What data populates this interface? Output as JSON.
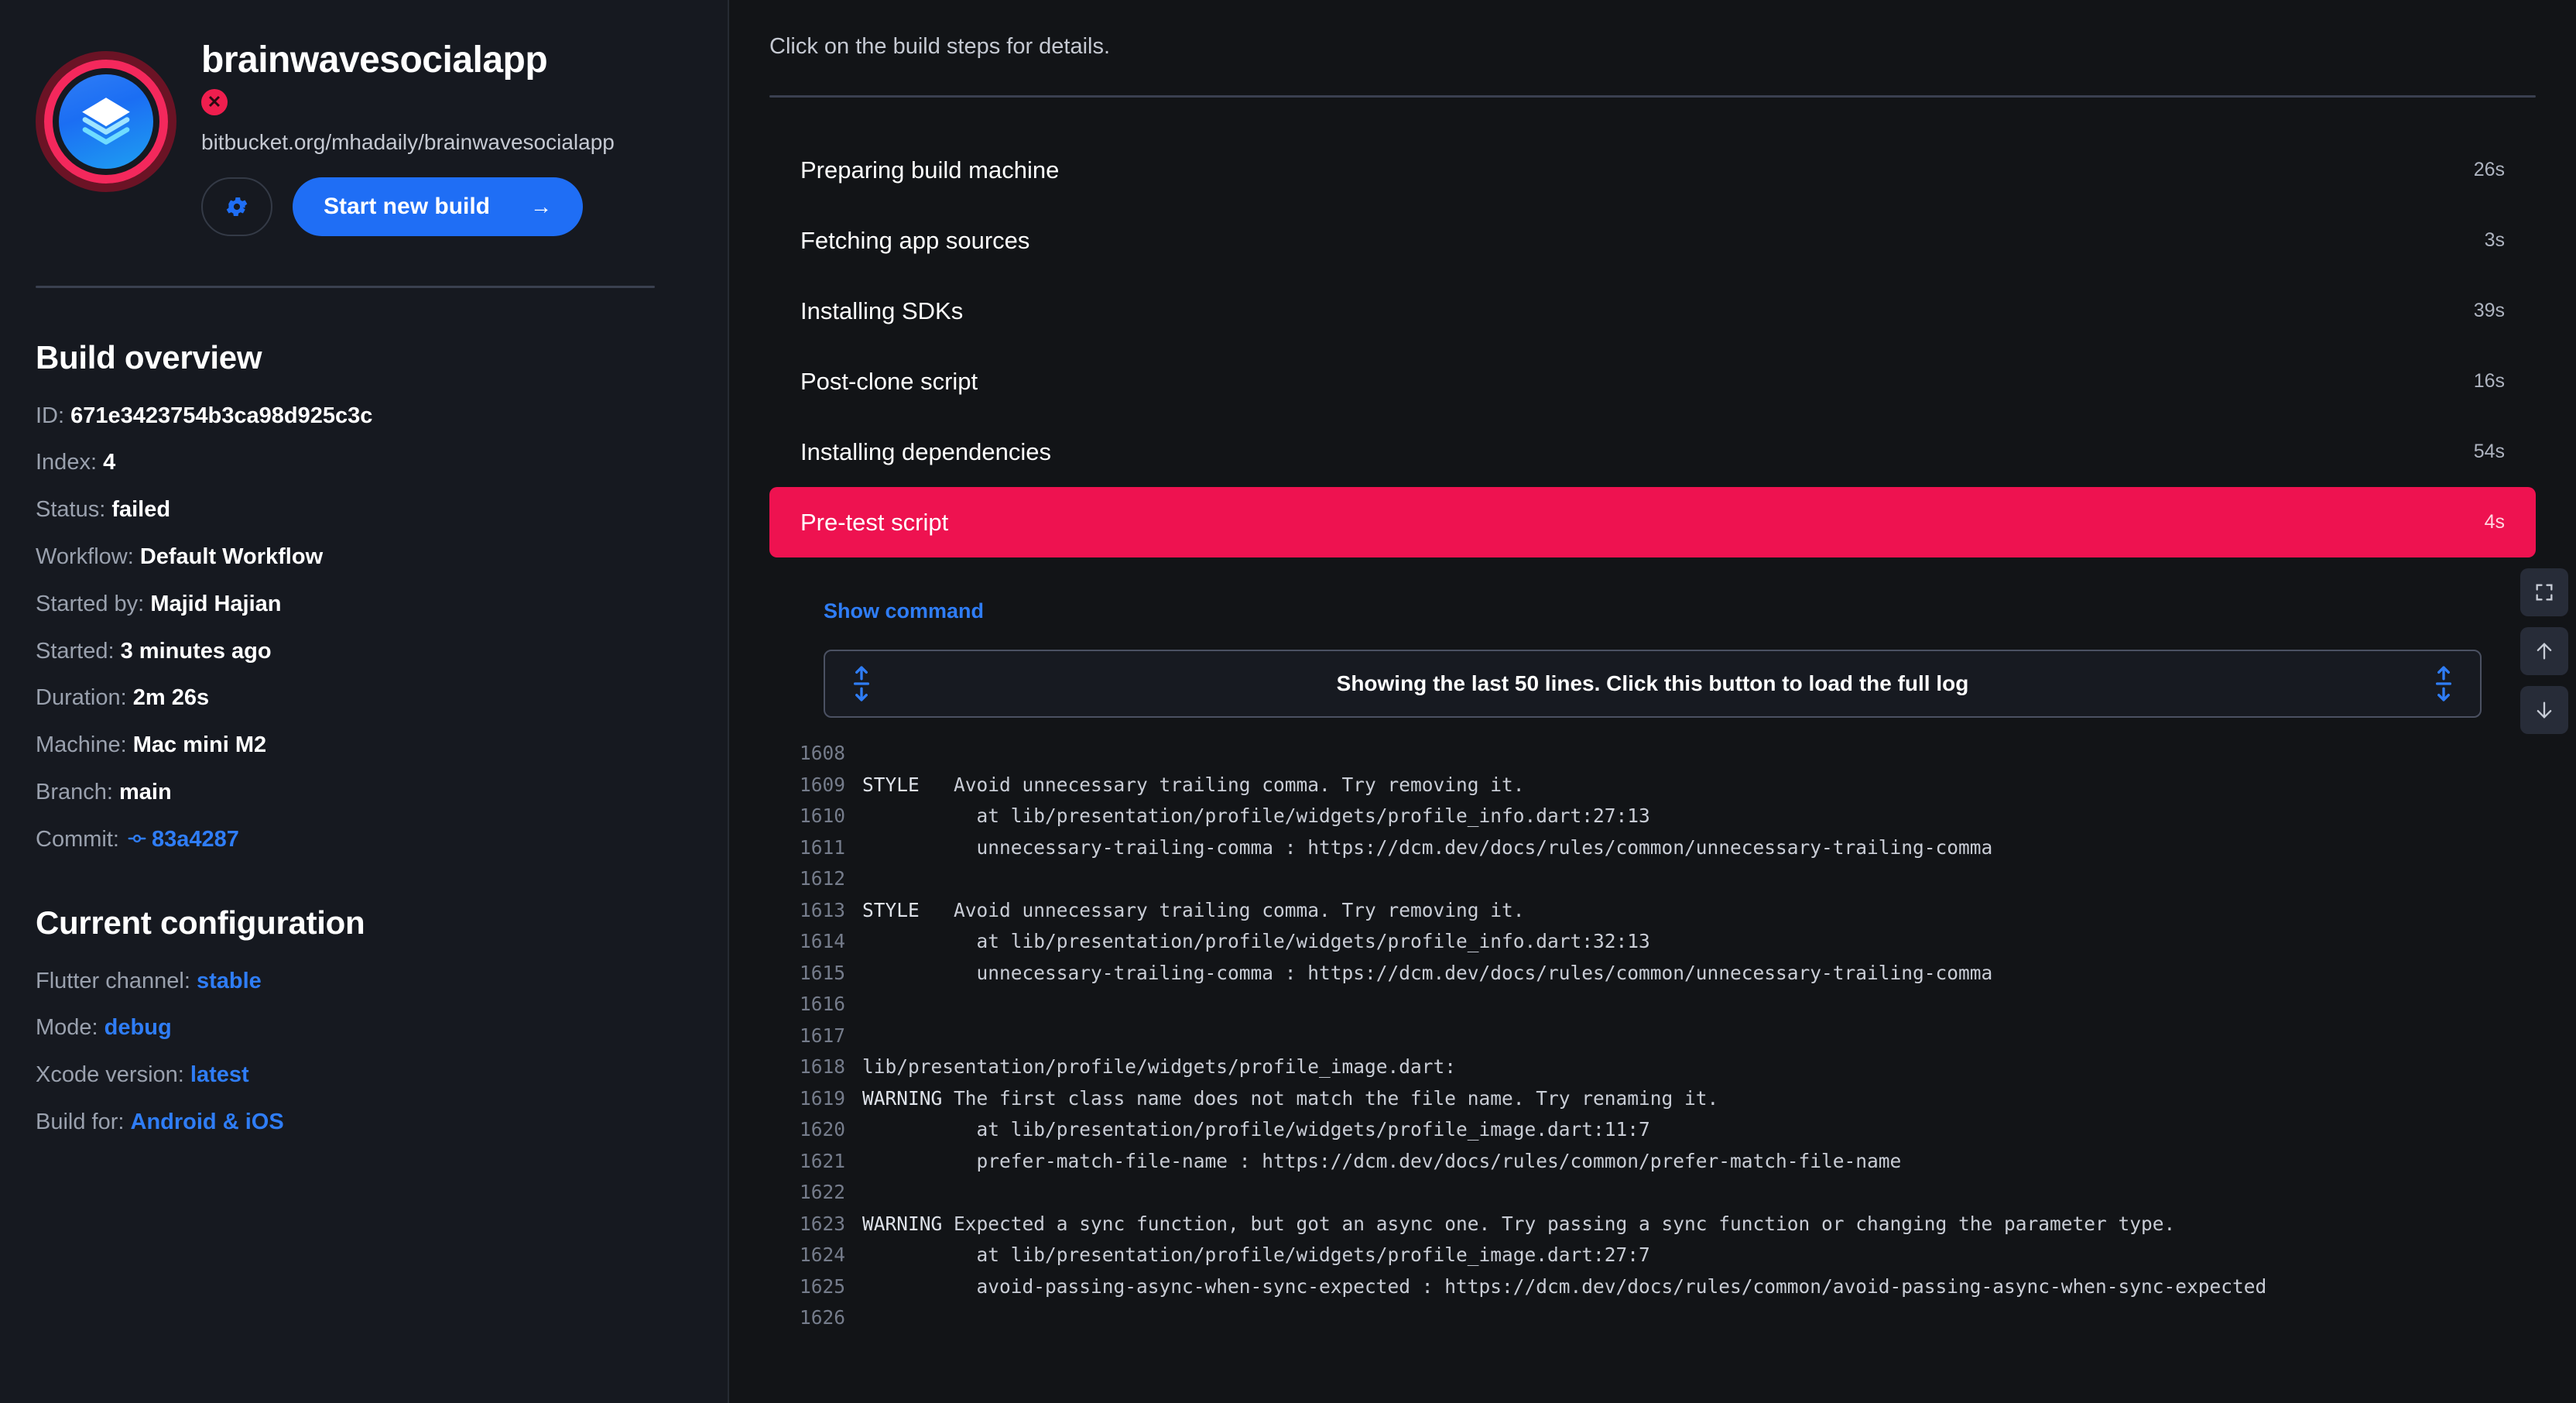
{
  "app": {
    "name": "brainwavesocialapp",
    "repo_url": "bitbucket.org/mhadaily/brainwavesocialapp",
    "status_icon": "failed-x-icon",
    "settings_icon": "gear-icon",
    "start_build_label": "Start new build",
    "start_build_arrow": "→",
    "accent_blue": "#1f6ef5",
    "accent_red": "#ee1250"
  },
  "build_overview": {
    "title": "Build overview",
    "rows": [
      {
        "label": "ID:",
        "value": "671e3423754b3ca98d925c3c",
        "link": false
      },
      {
        "label": "Index:",
        "value": "4",
        "link": false
      },
      {
        "label": "Status:",
        "value": "failed",
        "link": false
      },
      {
        "label": "Workflow:",
        "value": "Default Workflow",
        "link": false
      },
      {
        "label": "Started by:",
        "value": "Majid Hajian",
        "link": false
      },
      {
        "label": "Started:",
        "value": "3 minutes ago",
        "link": false
      },
      {
        "label": "Duration:",
        "value": "2m 26s",
        "link": false
      },
      {
        "label": "Machine:",
        "value": "Mac mini M2",
        "link": false
      },
      {
        "label": "Branch:",
        "value": "main",
        "link": false
      },
      {
        "label": "Commit:",
        "value": "83a4287",
        "link": true,
        "icon": "git-commit-icon"
      }
    ]
  },
  "current_configuration": {
    "title": "Current configuration",
    "rows": [
      {
        "label": "Flutter channel:",
        "value": "stable"
      },
      {
        "label": "Mode:",
        "value": "debug"
      },
      {
        "label": "Xcode version:",
        "value": "latest"
      },
      {
        "label": "Build for:",
        "value": "Android & iOS"
      }
    ]
  },
  "main": {
    "hint": "Click on the build steps for details.",
    "steps": [
      {
        "label": "Preparing build machine",
        "time": "26s",
        "state": "ok"
      },
      {
        "label": "Fetching app sources",
        "time": "3s",
        "state": "ok"
      },
      {
        "label": "Installing SDKs",
        "time": "39s",
        "state": "ok"
      },
      {
        "label": "Post-clone script",
        "time": "16s",
        "state": "ok"
      },
      {
        "label": "Installing dependencies",
        "time": "54s",
        "state": "ok"
      },
      {
        "label": "Pre-test script",
        "time": "4s",
        "state": "failed"
      }
    ],
    "show_command_label": "Show command",
    "load_full_log_label": "Showing the last 50 lines. Click this button to load the full log",
    "log_tools": [
      {
        "name": "expand-fullscreen-button",
        "icon": "fullscreen-icon"
      },
      {
        "name": "scroll-to-top-button",
        "icon": "arrow-up-icon"
      },
      {
        "name": "scroll-to-bottom-button",
        "icon": "arrow-down-icon"
      }
    ],
    "log_lines": [
      {
        "num": "1608",
        "sev": "",
        "text": ""
      },
      {
        "num": "1609",
        "sev": "STYLE",
        "text": "Avoid unnecessary trailing comma. Try removing it."
      },
      {
        "num": "1610",
        "sev": "",
        "text": "  at lib/presentation/profile/widgets/profile_info.dart:27:13"
      },
      {
        "num": "1611",
        "sev": "",
        "text": "  unnecessary-trailing-comma : https://dcm.dev/docs/rules/common/unnecessary-trailing-comma"
      },
      {
        "num": "1612",
        "sev": "",
        "text": ""
      },
      {
        "num": "1613",
        "sev": "STYLE",
        "text": "Avoid unnecessary trailing comma. Try removing it."
      },
      {
        "num": "1614",
        "sev": "",
        "text": "  at lib/presentation/profile/widgets/profile_info.dart:32:13"
      },
      {
        "num": "1615",
        "sev": "",
        "text": "  unnecessary-trailing-comma : https://dcm.dev/docs/rules/common/unnecessary-trailing-comma"
      },
      {
        "num": "1616",
        "sev": "",
        "text": ""
      },
      {
        "num": "1617",
        "sev": "",
        "text": ""
      },
      {
        "num": "1618",
        "sev": "",
        "text": "lib/presentation/profile/widgets/profile_image.dart:",
        "nosev": true
      },
      {
        "num": "1619",
        "sev": "WARNING",
        "text": "The first class name does not match the file name. Try renaming it."
      },
      {
        "num": "1620",
        "sev": "",
        "text": "  at lib/presentation/profile/widgets/profile_image.dart:11:7"
      },
      {
        "num": "1621",
        "sev": "",
        "text": "  prefer-match-file-name : https://dcm.dev/docs/rules/common/prefer-match-file-name"
      },
      {
        "num": "1622",
        "sev": "",
        "text": ""
      },
      {
        "num": "1623",
        "sev": "WARNING",
        "text": "Expected a sync function, but got an async one. Try passing a sync function or changing the parameter type."
      },
      {
        "num": "1624",
        "sev": "",
        "text": "  at lib/presentation/profile/widgets/profile_image.dart:27:7"
      },
      {
        "num": "1625",
        "sev": "",
        "text": "  avoid-passing-async-when-sync-expected : https://dcm.dev/docs/rules/common/avoid-passing-async-when-sync-expected"
      },
      {
        "num": "1626",
        "sev": "",
        "text": ""
      }
    ]
  }
}
